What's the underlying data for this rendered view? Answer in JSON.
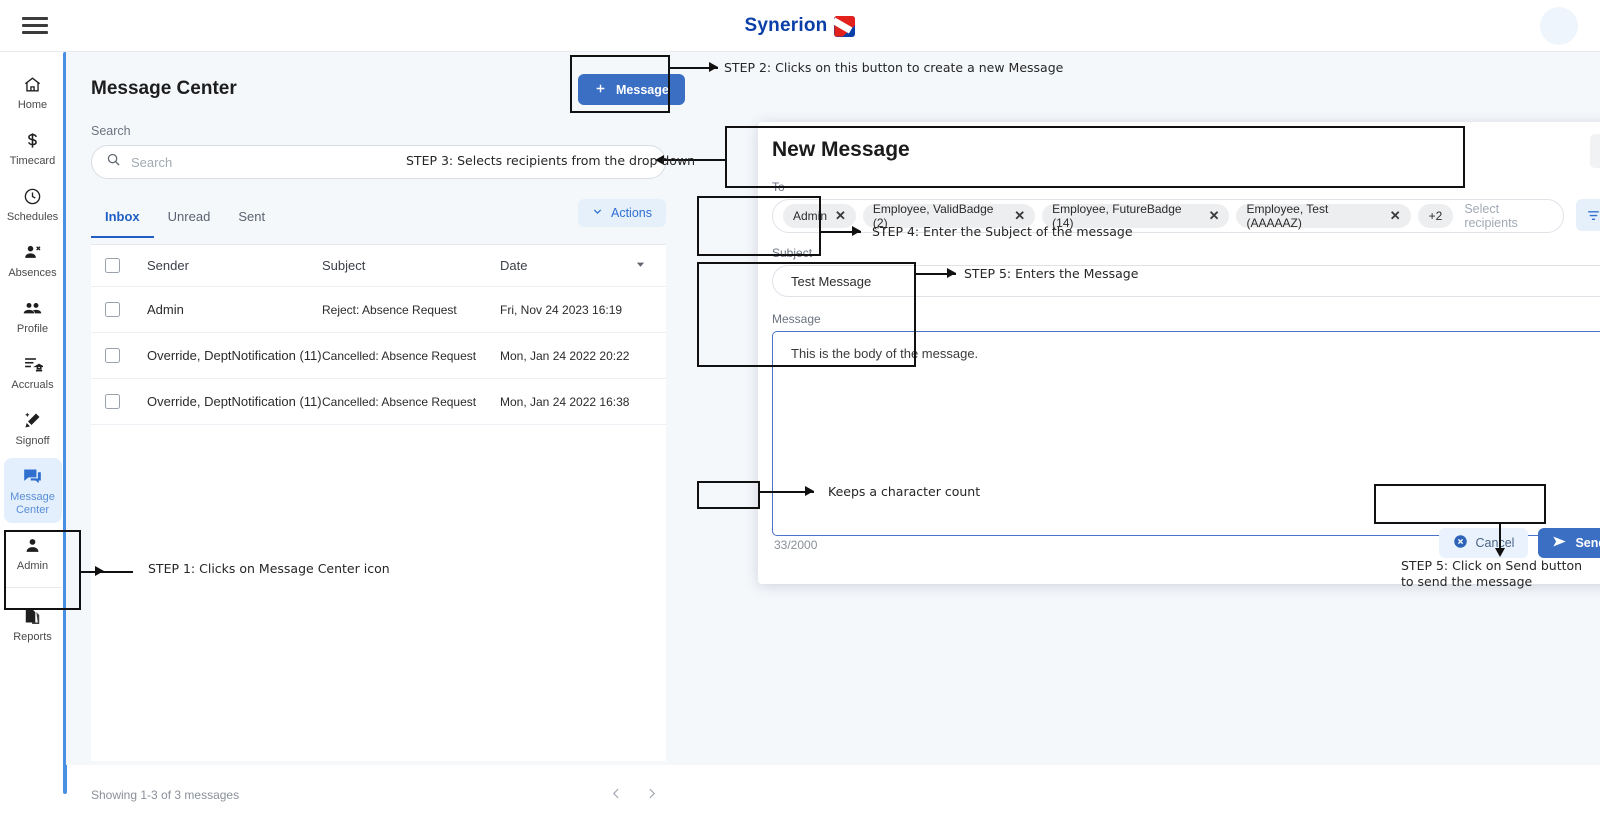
{
  "topbar": {
    "menu_icon": "hamburger-icon",
    "brand_name": "Synerion",
    "avatar_icon": "user-avatar"
  },
  "sidebar": {
    "items": [
      {
        "label": "Home",
        "icon": "home-icon",
        "active": false
      },
      {
        "label": "Timecard",
        "icon": "dollar-icon",
        "active": false
      },
      {
        "label": "Schedules",
        "icon": "clock-icon",
        "active": false
      },
      {
        "label": "Absences",
        "icon": "person-remove-icon",
        "active": false
      },
      {
        "label": "Profile",
        "icon": "people-icon",
        "active": false
      },
      {
        "label": "Accruals",
        "icon": "list-bank-icon",
        "active": false
      },
      {
        "label": "Signoff",
        "icon": "pen-sparkle-icon",
        "active": false
      },
      {
        "label": "Message Center",
        "icon": "chat-bubbles-icon",
        "active": true
      },
      {
        "label": "Admin",
        "icon": "person-icon",
        "active": false
      },
      {
        "label": "Reports",
        "icon": "document-copy-icon",
        "active": false
      }
    ]
  },
  "message_center": {
    "title": "Message Center",
    "search_label": "Search",
    "search_placeholder": "Search",
    "search_icon": "search-icon",
    "new_message_button": "Message",
    "plus_icon": "plus-icon",
    "tabs": [
      {
        "label": "Inbox",
        "active": true
      },
      {
        "label": "Unread",
        "active": false
      },
      {
        "label": "Sent",
        "active": false
      }
    ],
    "actions_button": "Actions",
    "actions_icon": "chevron-down-icon",
    "columns": [
      "Sender",
      "Subject",
      "Date"
    ],
    "rows": [
      {
        "sender": "Admin",
        "subject": "Reject: Absence Request",
        "date": "Fri, Nov 24 2023 16:19"
      },
      {
        "sender": "Override, DeptNotification (11)",
        "subject": "Cancelled: Absence Request",
        "date": "Mon, Jan 24 2022 20:22"
      },
      {
        "sender": "Override, DeptNotification (11)",
        "subject": "Cancelled: Absence Request",
        "date": "Mon, Jan 24 2022 16:38"
      }
    ],
    "footer_status": "Showing 1-3 of 3 messages",
    "prev_icon": "chevron-left-icon",
    "next_icon": "chevron-right-icon"
  },
  "dialog": {
    "title": "New Message",
    "close_icon": "close-icon",
    "to_label": "To",
    "recipients": [
      "Admin",
      "Employee, ValidBadge (2)",
      "Employee, FutureBadge (14)",
      "Employee, Test (AAAAAZ)"
    ],
    "overflow_chip": "+2",
    "recipients_placeholder": "Select recipients",
    "filter_icon": "filter-icon",
    "subject_label": "Subject",
    "subject_value": "Test Message",
    "message_label": "Message",
    "message_value": "This is the body of the message.",
    "char_count": "33/2000",
    "cancel_button": "Cancel",
    "cancel_icon": "circle-x-icon",
    "send_button": "Send",
    "send_icon": "paper-plane-icon"
  },
  "annotations": {
    "step1": "STEP 1: Clicks on Message Center icon",
    "step2": "STEP 2: Clicks on this button to create a new Message",
    "step3": "STEP 3: Selects recipients from the drop down",
    "step4": "STEP 4: Enter the Subject of the message",
    "step5_message": "STEP 5: Enters the Message",
    "char_note": "Keeps a character count",
    "step5_send_line1": "STEP 5: Click on Send button",
    "step5_send_line2": "to send the message"
  },
  "colors": {
    "primary_blue": "#3b6fc4",
    "brand_blue": "#0a3fa8",
    "brand_red": "#e2211c",
    "active_tab": "#1f5fc4",
    "light_blue_bg": "#e6f0fb",
    "page_bg": "#f5f8fb"
  }
}
